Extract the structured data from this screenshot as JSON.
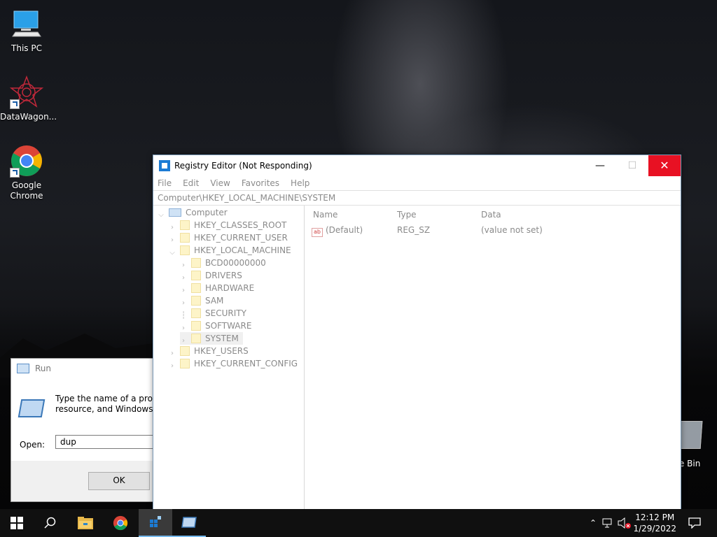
{
  "desktop": {
    "icons": [
      {
        "label": "This PC"
      },
      {
        "label": "DataWagon..."
      },
      {
        "label": "Google Chrome"
      }
    ],
    "recycle_bin_label": "cle Bin"
  },
  "run_dialog": {
    "title": "Run",
    "message_line1": "Type the name of a progra",
    "message_line2": "resource, and Windows wi",
    "open_label": "Open:",
    "open_value": "dup",
    "ok_label": "OK"
  },
  "regedit": {
    "title": "Registry Editor (Not Responding)",
    "menu": [
      "File",
      "Edit",
      "View",
      "Favorites",
      "Help"
    ],
    "address": "Computer\\HKEY_LOCAL_MACHINE\\SYSTEM",
    "tree": {
      "root": "Computer",
      "hives": [
        "HKEY_CLASSES_ROOT",
        "HKEY_CURRENT_USER",
        "HKEY_LOCAL_MACHINE",
        "HKEY_USERS",
        "HKEY_CURRENT_CONFIG"
      ],
      "hklm_children": [
        "BCD00000000",
        "DRIVERS",
        "HARDWARE",
        "SAM",
        "SECURITY",
        "SOFTWARE",
        "SYSTEM"
      ],
      "selected": "SYSTEM"
    },
    "columns": {
      "name": "Name",
      "type": "Type",
      "data": "Data"
    },
    "values": [
      {
        "name": "(Default)",
        "type": "REG_SZ",
        "data": "(value not set)",
        "icon": "ab-string-icon"
      }
    ],
    "window_buttons": {
      "minimize": "—",
      "maximize": "☐",
      "close": "✕"
    }
  },
  "taskbar": {
    "time": "12:12 PM",
    "date": "1/29/2022",
    "accent": "#76b9ed"
  }
}
